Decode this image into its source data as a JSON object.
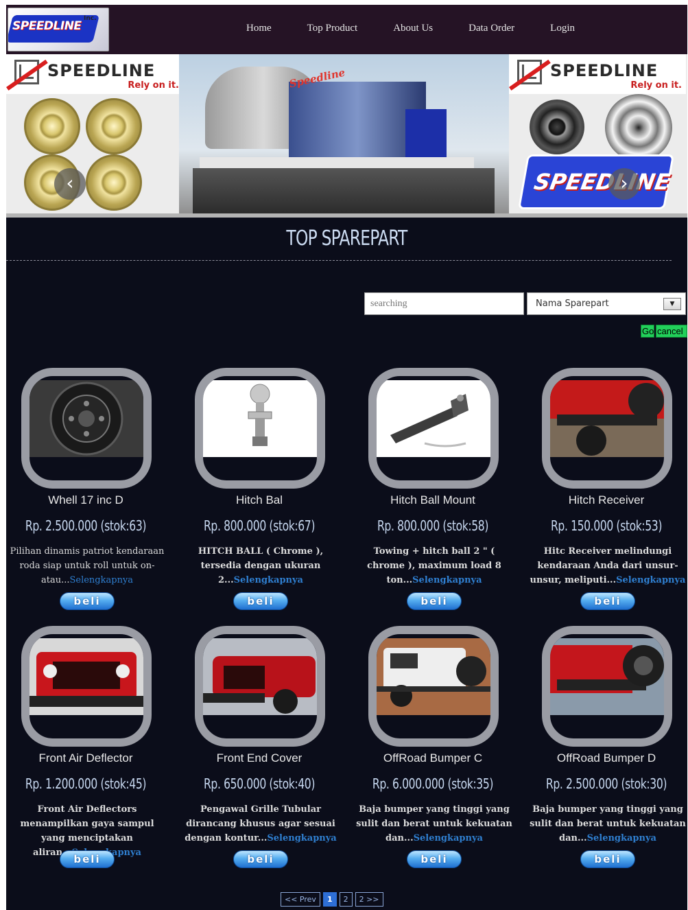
{
  "header": {
    "logo_text": "SPEEDLINE",
    "logo_inc": "Inc.",
    "nav": [
      "Home",
      "Top Product",
      "About Us",
      "Data Order",
      "Login"
    ]
  },
  "banner": {
    "brand": "SPEEDLINE",
    "tagline": "Rely on it.",
    "building_sign": "Speedline",
    "prev_arrow": "‹",
    "next_arrow": "›"
  },
  "section_title": "TOP SPAREPART",
  "search": {
    "placeholder": "searching",
    "select_value": "Nama Sparepart",
    "go_label": "Go",
    "cancel_label": "cancel"
  },
  "buy_label": "beli",
  "more_label": "Selengkapnya",
  "products": [
    {
      "name": "Whell 17 inc D",
      "price": "Rp. 2.500.000   (stok:63)",
      "desc": "Pilihan dinamis patriot kendaraan roda siap untuk roll untuk on-atau..."
    },
    {
      "name": "Hitch Bal",
      "price": "Rp. 800.000   (stok:67)",
      "desc": "HITCH BALL ( Chrome ), tersedia dengan ukuran 2..."
    },
    {
      "name": "Hitch Ball Mount",
      "price": "Rp. 800.000   (stok:58)",
      "desc": "Towing + hitch ball 2 \" ( chrome ), maximum load 8 ton..."
    },
    {
      "name": "Hitch Receiver",
      "price": "Rp. 150.000   (stok:53)",
      "desc": "Hitc Receiver melindungi kendaraan Anda dari unsur-unsur, meliputi..."
    },
    {
      "name": "Front Air Deflector",
      "price": "Rp. 1.200.000   (stok:45)",
      "desc": "Front Air Deflectors menampilkan gaya sampul yang menciptakan aliran..."
    },
    {
      "name": "Front End Cover",
      "price": "Rp. 650.000   (stok:40)",
      "desc": "Pengawal Grille Tubular dirancang khusus agar sesuai dengan kontur..."
    },
    {
      "name": "OffRoad Bumper C",
      "price": "Rp. 6.000.000   (stok:35)",
      "desc": "Baja bumper yang tinggi yang sulit dan berat untuk kekuatan dan..."
    },
    {
      "name": "OffRoad Bumper D",
      "price": "Rp. 2.500.000   (stok:30)",
      "desc": "Baja bumper yang tinggi yang sulit dan berat untuk kekuatan dan..."
    }
  ],
  "pagination": {
    "prev": "<< Prev",
    "pages": [
      "1",
      "2"
    ],
    "next": "2 >>",
    "active": "1"
  },
  "colors": {
    "accent": "#2e6fd6",
    "background": "#0b0d1a",
    "header": "#251325",
    "link": "#2f7fd0"
  }
}
